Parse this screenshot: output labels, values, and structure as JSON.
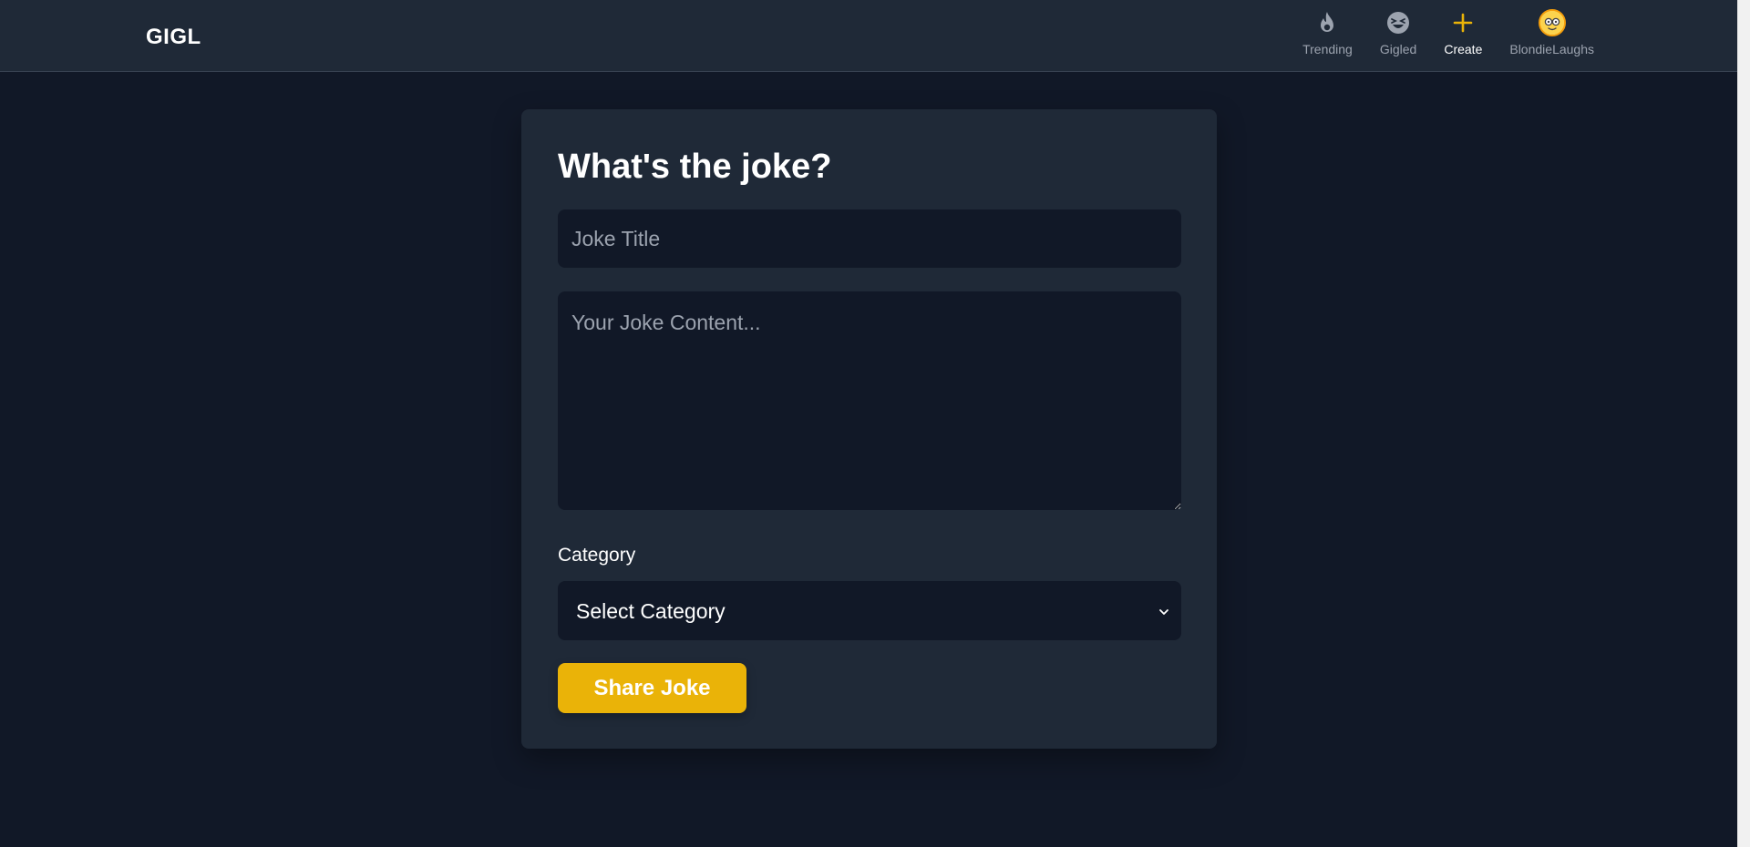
{
  "app": {
    "logo": "GIGL"
  },
  "nav": {
    "items": [
      {
        "label": "Trending",
        "icon": "flame-icon"
      },
      {
        "label": "Gigled",
        "icon": "laughing-face-icon"
      },
      {
        "label": "Create",
        "icon": "plus-icon"
      },
      {
        "label": "BlondieLaughs",
        "icon": "avatar-icon"
      }
    ],
    "active": "Create"
  },
  "form": {
    "heading": "What's the joke?",
    "title_placeholder": "Joke Title",
    "title_value": "",
    "content_placeholder": "Your Joke Content...",
    "content_value": "",
    "category_label": "Category",
    "category_selected": "Select Category",
    "submit_label": "Share Joke"
  },
  "colors": {
    "background": "#111827",
    "surface": "#1f2937",
    "accent": "#eab308",
    "muted_text": "#9ca3af"
  }
}
